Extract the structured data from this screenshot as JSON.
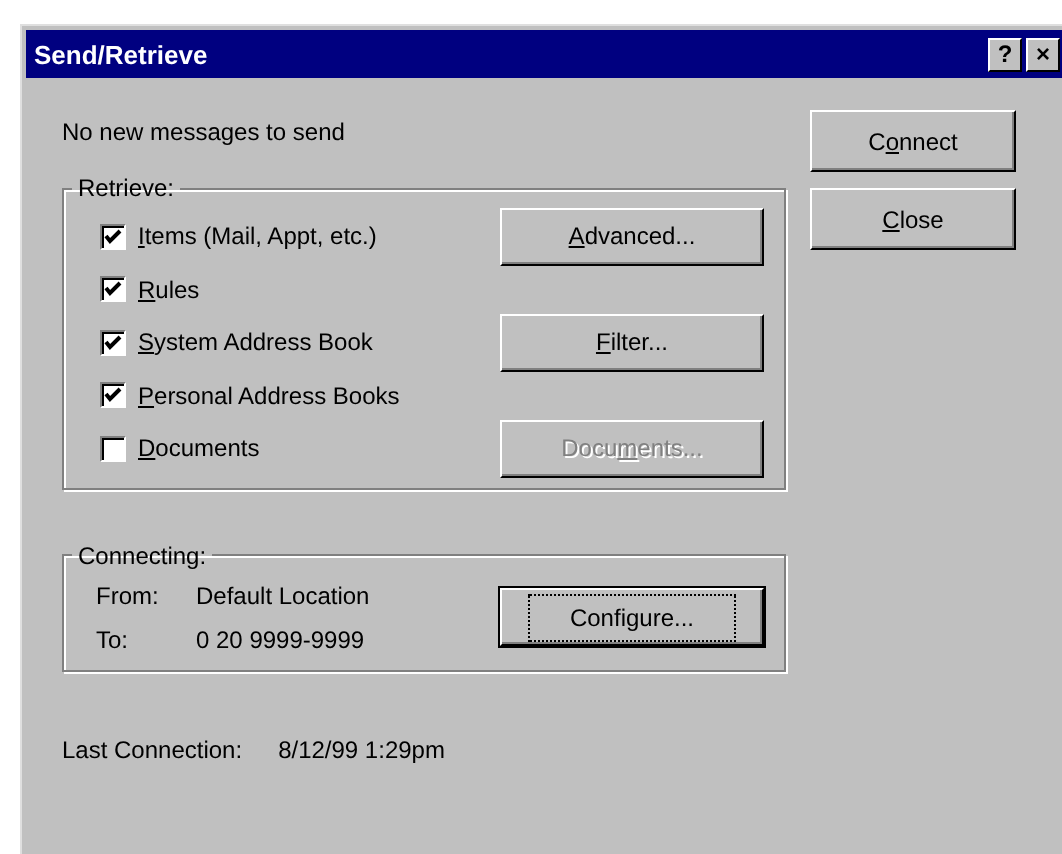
{
  "window": {
    "title": "Send/Retrieve",
    "title_buttons": [
      "?",
      "×"
    ]
  },
  "status_message": "No new messages to send",
  "side_buttons": [
    {
      "label": {
        "pre": "C",
        "key": "o",
        "post": "nnect"
      },
      "disabled": false,
      "default": false
    },
    {
      "label": {
        "key": "C",
        "post": "lose"
      },
      "disabled": false,
      "default": false
    }
  ],
  "retrieve": {
    "legend": "Retrieve:",
    "items": [
      {
        "label": {
          "key": "I",
          "post": "tems (Mail, Appt, etc.)"
        },
        "checked": true,
        "button": {
          "label": {
            "key": "A",
            "post": "dvanced..."
          },
          "disabled": false
        }
      },
      {
        "label": {
          "key": "R",
          "post": "ules"
        },
        "checked": true
      },
      {
        "label": {
          "key": "S",
          "post": "ystem Address Book"
        },
        "checked": true,
        "button": {
          "label": {
            "key": "F",
            "post": "ilter..."
          },
          "disabled": false
        }
      },
      {
        "label": {
          "key": "P",
          "post": "ersonal Address Books"
        },
        "checked": true
      },
      {
        "label": {
          "key": "D",
          "post": "ocuments"
        },
        "checked": false,
        "button": {
          "label": {
            "pre": "Docu",
            "key": "m",
            "post": "ents..."
          },
          "disabled": true
        }
      }
    ]
  },
  "connecting": {
    "legend": "Connecting:",
    "rows": [
      {
        "label": "From:",
        "value": "Default Location"
      },
      {
        "label": "To:",
        "value": "0 20 9999-9999"
      }
    ],
    "button": {
      "label": {
        "pre": "Configure..."
      },
      "default": true,
      "disabled": false
    }
  },
  "last_connection": {
    "label": "Last Connection:",
    "value": "8/12/99 1:29pm"
  }
}
